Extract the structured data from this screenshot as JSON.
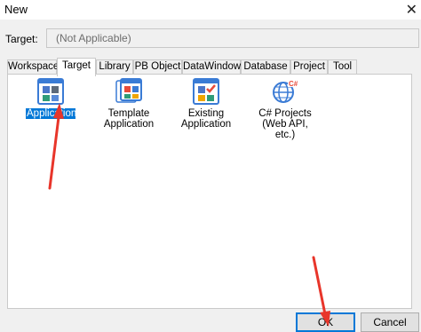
{
  "window": {
    "title": "New",
    "close_glyph": "✕"
  },
  "target": {
    "label": "Target:",
    "value": "(Not Applicable)"
  },
  "tabs": [
    {
      "label": "Workspace"
    },
    {
      "label": "Target",
      "active": true
    },
    {
      "label": "Library"
    },
    {
      "label": "PB Object"
    },
    {
      "label": "DataWindow"
    },
    {
      "label": "Database"
    },
    {
      "label": "Project"
    },
    {
      "label": "Tool"
    }
  ],
  "items": [
    {
      "label": "Application",
      "icon": "application-icon",
      "selected": true
    },
    {
      "label": "Template Application",
      "icon": "template-application-icon"
    },
    {
      "label": "Existing Application",
      "icon": "existing-application-icon"
    },
    {
      "label": "C# Projects (Web API, etc.)",
      "icon": "csharp-projects-icon"
    }
  ],
  "buttons": {
    "ok": "OK",
    "cancel": "Cancel"
  },
  "colors": {
    "annotation_arrow": "#e8352a",
    "selection": "#0078d7"
  }
}
